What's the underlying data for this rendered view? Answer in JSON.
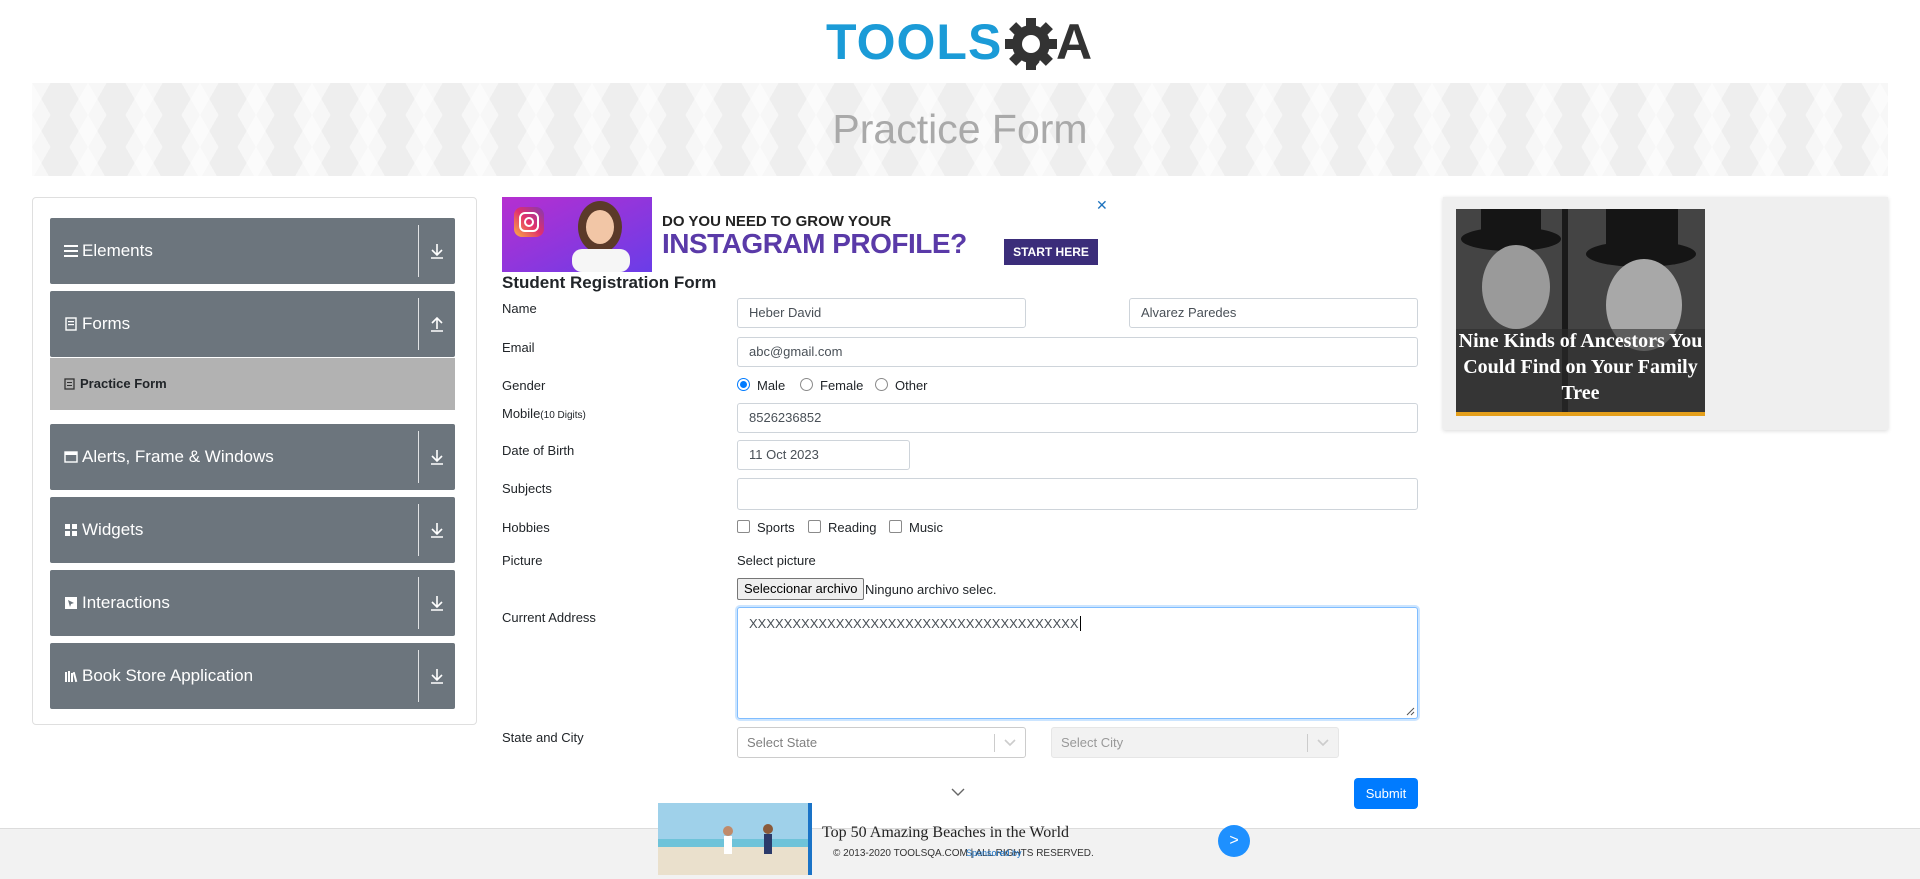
{
  "header": {
    "logo_text_left": "TOOLS",
    "logo_text_right": "A",
    "page_title": "Practice Form"
  },
  "sidebar": {
    "groups": [
      {
        "label": "Elements",
        "icon": "hamburger-icon",
        "arrow": "download-arrow-icon"
      },
      {
        "label": "Forms",
        "icon": "document-icon",
        "arrow": "upload-arrow-icon"
      },
      {
        "label": "Alerts, Frame & Windows",
        "icon": "window-icon",
        "arrow": "download-arrow-icon"
      },
      {
        "label": "Widgets",
        "icon": "grid-icon",
        "arrow": "download-arrow-icon"
      },
      {
        "label": "Interactions",
        "icon": "cursor-icon",
        "arrow": "download-arrow-icon"
      },
      {
        "label": "Book Store Application",
        "icon": "books-icon",
        "arrow": "download-arrow-icon"
      }
    ],
    "active_sub_item": "Practice Form"
  },
  "ad_top": {
    "line1": "DO YOU NEED TO GROW YOUR",
    "line2": "INSTAGRAM PROFILE?",
    "cta": "START HERE",
    "close": "✕"
  },
  "form": {
    "title": "Student Registration Form",
    "labels": {
      "name": "Name",
      "email": "Email",
      "gender": "Gender",
      "mobile": "Mobile",
      "mobile_hint": "(10 Digits)",
      "dob": "Date of Birth",
      "subjects": "Subjects",
      "hobbies": "Hobbies",
      "picture": "Picture",
      "address": "Current Address",
      "state_city": "State and City"
    },
    "first_name": "Heber David",
    "last_name": "Alvarez Paredes",
    "email": "abc@gmail.com",
    "gender_options": [
      "Male",
      "Female",
      "Other"
    ],
    "gender_selected": "Male",
    "mobile": "8526236852",
    "dob": "11 Oct 2023",
    "subjects": "",
    "hobbies": [
      "Sports",
      "Reading",
      "Music"
    ],
    "picture_label": "Select picture",
    "file_button": "Seleccionar archivo",
    "file_status": "Ninguno archivo selec.",
    "address": "XXXXXXXXXXXXXXXXXXXXXXXXXXXXXXXXXXXXXX",
    "state_placeholder": "Select State",
    "city_placeholder": "Select City",
    "submit": "Submit"
  },
  "ad_right": {
    "headline": "Nine Kinds of Ancestors You Could Find on Your Family Tree"
  },
  "footer": {
    "copyright": "© 2013-2020 TOOLSQA.COM | ALL RIGHTS RESERVED.",
    "ad_title": "Top 50 Amazing Beaches in the World",
    "ad_sponsor": "Sponsored by",
    "ad_button": ">"
  },
  "colors": {
    "accent": "#007bff",
    "sidebar_group": "#6c757d",
    "sidebar_active": "#b2b2b2",
    "logo_blue": "#1b9bd7",
    "logo_dark": "#333333"
  }
}
